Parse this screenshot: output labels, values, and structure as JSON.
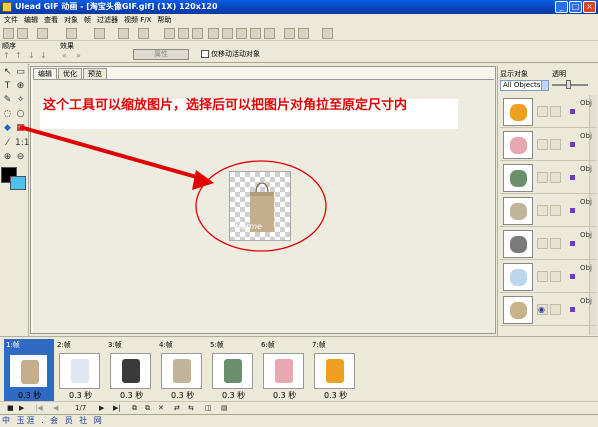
{
  "window": {
    "title": "Ulead GIF 动画 - [淘宝头像GIF.gif] (1X) 120x120",
    "minimize": "_",
    "maximize": "□",
    "close": "×"
  },
  "menu": [
    "文件",
    "编辑",
    "查看",
    "对象",
    "帧",
    "过滤器",
    "视频 F/X",
    "帮助"
  ],
  "toolbar2": {
    "frames_label": "顺序",
    "effects_label": "效果",
    "effects_button": "属性",
    "move_label": "仅移动活动对象"
  },
  "tabs": [
    "编辑",
    "优化",
    "预览"
  ],
  "callout": "这个工具可以缩放图片，选择后可以把图片对角拉至原定尺寸内",
  "image_overlay_text": "Herme",
  "right_panel": {
    "label_display": "显示对象",
    "label_opacity": "透明",
    "select_value": "All Objects",
    "layer_text": "Obj",
    "layers": 7
  },
  "frames": [
    {
      "label": "1:帧",
      "delay": "0.3 秒"
    },
    {
      "label": "2:帧",
      "delay": "0.3 秒"
    },
    {
      "label": "3:帧",
      "delay": "0.3 秒"
    },
    {
      "label": "4:帧",
      "delay": "0.3 秒"
    },
    {
      "label": "5:帧",
      "delay": "0.3 秒"
    },
    {
      "label": "6:帧",
      "delay": "0.3 秒"
    },
    {
      "label": "7:帧",
      "delay": "0.3 秒"
    }
  ],
  "playbar": {
    "frame_counter": "1/7"
  },
  "status": "中 玉涯 . 会 员 社 网",
  "colors": {
    "foreground": "#000000",
    "background": "#4ec0ee",
    "annotation_red": "#e00000"
  }
}
